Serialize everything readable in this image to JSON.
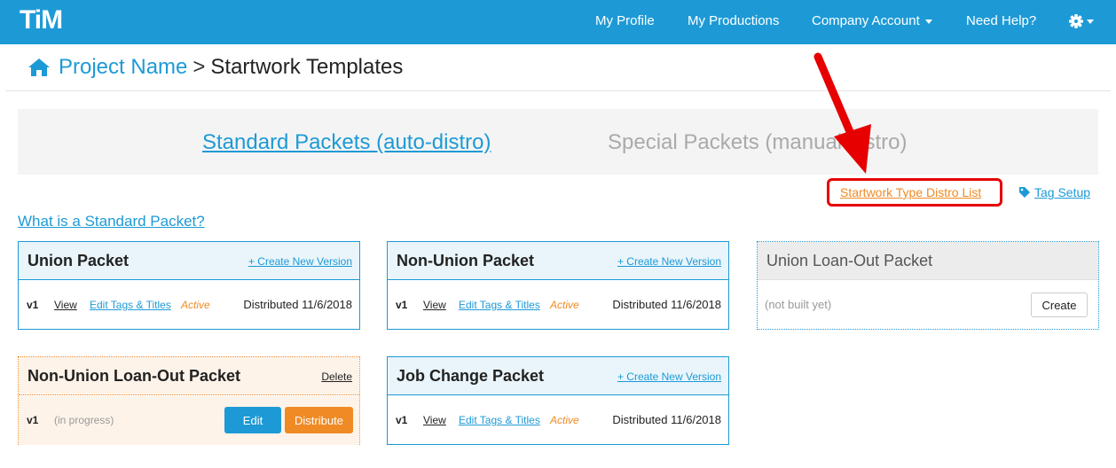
{
  "nav": {
    "logo": "TiM",
    "items": [
      "My Profile",
      "My Productions",
      "Company Account",
      "Need Help?"
    ]
  },
  "breadcrumb": {
    "project": "Project Name",
    "separator": ">",
    "current": "Startwork Templates"
  },
  "tabs": {
    "standard": "Standard Packets (auto-distro)",
    "special": "Special Packets (manual distro)"
  },
  "links": {
    "distro_list": "Startwork Type Distro List",
    "tag_setup": "Tag Setup",
    "what_is": "What is a Standard Packet?"
  },
  "packets": {
    "union": {
      "title": "Union Packet",
      "create": "+ Create New Version",
      "version": "v1",
      "view": "View",
      "edit_tags": "Edit Tags & Titles",
      "status": "Active",
      "distributed": "Distributed 11/6/2018"
    },
    "non_union": {
      "title": "Non-Union Packet",
      "create": "+ Create New Version",
      "version": "v1",
      "view": "View",
      "edit_tags": "Edit Tags & Titles",
      "status": "Active",
      "distributed": "Distributed 11/6/2018"
    },
    "union_loanout": {
      "title": "Union Loan-Out Packet",
      "status": "(not built yet)",
      "create_button": "Create"
    },
    "non_union_loanout": {
      "title": "Non-Union Loan-Out Packet",
      "delete": "Delete",
      "version": "v1",
      "status": "(in progress)",
      "edit_button": "Edit",
      "distribute_button": "Distribute"
    },
    "job_change": {
      "title": "Job Change Packet",
      "create": "+ Create New Version",
      "version": "v1",
      "view": "View",
      "edit_tags": "Edit Tags & Titles",
      "status": "Active",
      "distributed": "Distributed 11/6/2018"
    }
  },
  "colors": {
    "brand_blue": "#1d9ad6",
    "accent_orange": "#f08a24",
    "annotation_red": "#e60000"
  }
}
